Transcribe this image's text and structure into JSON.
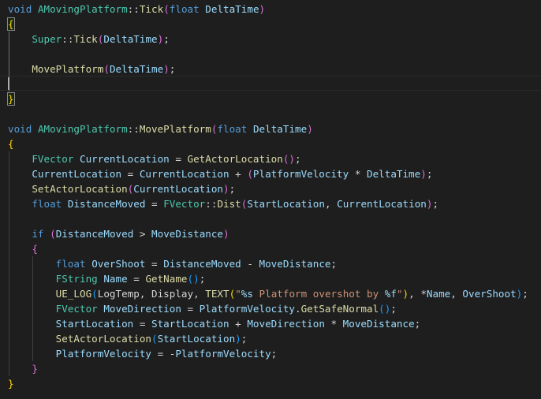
{
  "colors": {
    "background": "#1e1e1e",
    "default": "#d4d4d4",
    "keyword": "#569cd6",
    "function": "#dcdcaa",
    "type": "#4ec9b0",
    "variable": "#9cdcfe",
    "string": "#ce9178",
    "format": "#9cdcfe",
    "brace1": "#ffd700",
    "brace2": "#da70d6",
    "brace3": "#179fff"
  },
  "lines": [
    [
      [
        "void",
        "keyword"
      ],
      [
        " ",
        "default"
      ],
      [
        "AMovingPlatform",
        "type"
      ],
      [
        "::",
        "default"
      ],
      [
        "Tick",
        "function"
      ],
      [
        "(",
        "brace2"
      ],
      [
        "float",
        "keyword"
      ],
      [
        " ",
        "default"
      ],
      [
        "DeltaTime",
        "variable"
      ],
      [
        ")",
        "brace2"
      ]
    ],
    [
      [
        "{",
        "brace1"
      ]
    ],
    [
      [
        "    ",
        "default"
      ],
      [
        "Super",
        "type"
      ],
      [
        "::",
        "default"
      ],
      [
        "Tick",
        "function"
      ],
      [
        "(",
        "brace2"
      ],
      [
        "DeltaTime",
        "variable"
      ],
      [
        ")",
        "brace2"
      ],
      [
        ";",
        "default"
      ]
    ],
    [],
    [
      [
        "    ",
        "default"
      ],
      [
        "MovePlatform",
        "function"
      ],
      [
        "(",
        "brace2"
      ],
      [
        "DeltaTime",
        "variable"
      ],
      [
        ")",
        "brace2"
      ],
      [
        ";",
        "default"
      ]
    ],
    [],
    [
      [
        "}",
        "brace1"
      ]
    ],
    [],
    [
      [
        "void",
        "keyword"
      ],
      [
        " ",
        "default"
      ],
      [
        "AMovingPlatform",
        "type"
      ],
      [
        "::",
        "default"
      ],
      [
        "MovePlatform",
        "function"
      ],
      [
        "(",
        "brace2"
      ],
      [
        "float",
        "keyword"
      ],
      [
        " ",
        "default"
      ],
      [
        "DeltaTime",
        "variable"
      ],
      [
        ")",
        "brace2"
      ]
    ],
    [
      [
        "{",
        "brace1"
      ]
    ],
    [
      [
        "    ",
        "default"
      ],
      [
        "FVector",
        "type"
      ],
      [
        " ",
        "default"
      ],
      [
        "CurrentLocation",
        "variable"
      ],
      [
        " = ",
        "default"
      ],
      [
        "GetActorLocation",
        "function"
      ],
      [
        "()",
        "brace2"
      ],
      [
        ";",
        "default"
      ]
    ],
    [
      [
        "    ",
        "default"
      ],
      [
        "CurrentLocation",
        "variable"
      ],
      [
        " = ",
        "default"
      ],
      [
        "CurrentLocation",
        "variable"
      ],
      [
        " + ",
        "default"
      ],
      [
        "(",
        "brace2"
      ],
      [
        "PlatformVelocity",
        "variable"
      ],
      [
        " * ",
        "default"
      ],
      [
        "DeltaTime",
        "variable"
      ],
      [
        ")",
        "brace2"
      ],
      [
        ";",
        "default"
      ]
    ],
    [
      [
        "    ",
        "default"
      ],
      [
        "SetActorLocation",
        "function"
      ],
      [
        "(",
        "brace2"
      ],
      [
        "CurrentLocation",
        "variable"
      ],
      [
        ")",
        "brace2"
      ],
      [
        ";",
        "default"
      ]
    ],
    [
      [
        "    ",
        "default"
      ],
      [
        "float",
        "keyword"
      ],
      [
        " ",
        "default"
      ],
      [
        "DistanceMoved",
        "variable"
      ],
      [
        " = ",
        "default"
      ],
      [
        "FVector",
        "type"
      ],
      [
        "::",
        "default"
      ],
      [
        "Dist",
        "function"
      ],
      [
        "(",
        "brace2"
      ],
      [
        "StartLocation",
        "variable"
      ],
      [
        ", ",
        "default"
      ],
      [
        "CurrentLocation",
        "variable"
      ],
      [
        ")",
        "brace2"
      ],
      [
        ";",
        "default"
      ]
    ],
    [],
    [
      [
        "    ",
        "default"
      ],
      [
        "if",
        "keyword"
      ],
      [
        " ",
        "default"
      ],
      [
        "(",
        "brace2"
      ],
      [
        "DistanceMoved",
        "variable"
      ],
      [
        " > ",
        "default"
      ],
      [
        "MoveDistance",
        "variable"
      ],
      [
        ")",
        "brace2"
      ]
    ],
    [
      [
        "    ",
        "default"
      ],
      [
        "{",
        "brace2"
      ]
    ],
    [
      [
        "        ",
        "default"
      ],
      [
        "float",
        "keyword"
      ],
      [
        " ",
        "default"
      ],
      [
        "OverShoot",
        "variable"
      ],
      [
        " = ",
        "default"
      ],
      [
        "DistanceMoved",
        "variable"
      ],
      [
        " - ",
        "default"
      ],
      [
        "MoveDistance",
        "variable"
      ],
      [
        ";",
        "default"
      ]
    ],
    [
      [
        "        ",
        "default"
      ],
      [
        "FString",
        "type"
      ],
      [
        " ",
        "default"
      ],
      [
        "Name",
        "variable"
      ],
      [
        " = ",
        "default"
      ],
      [
        "GetName",
        "function"
      ],
      [
        "()",
        "brace3"
      ],
      [
        ";",
        "default"
      ]
    ],
    [
      [
        "        ",
        "default"
      ],
      [
        "UE_LOG",
        "function"
      ],
      [
        "(",
        "brace3"
      ],
      [
        "LogTemp",
        "default"
      ],
      [
        ", ",
        "default"
      ],
      [
        "Display",
        "default"
      ],
      [
        ", ",
        "default"
      ],
      [
        "TEXT",
        "function"
      ],
      [
        "(",
        "brace1"
      ],
      [
        "\"",
        "string"
      ],
      [
        "%s",
        "format"
      ],
      [
        " Platform overshot by ",
        "string"
      ],
      [
        "%f",
        "format"
      ],
      [
        "\"",
        "string"
      ],
      [
        ")",
        "brace1"
      ],
      [
        ", ",
        "default"
      ],
      [
        "*",
        "default"
      ],
      [
        "Name",
        "variable"
      ],
      [
        ", ",
        "default"
      ],
      [
        "OverShoot",
        "variable"
      ],
      [
        ")",
        "brace3"
      ],
      [
        ";",
        "default"
      ]
    ],
    [
      [
        "        ",
        "default"
      ],
      [
        "FVector",
        "type"
      ],
      [
        " ",
        "default"
      ],
      [
        "MoveDirection",
        "variable"
      ],
      [
        " = ",
        "default"
      ],
      [
        "PlatformVelocity",
        "variable"
      ],
      [
        ".",
        "default"
      ],
      [
        "GetSafeNormal",
        "function"
      ],
      [
        "()",
        "brace3"
      ],
      [
        ";",
        "default"
      ]
    ],
    [
      [
        "        ",
        "default"
      ],
      [
        "StartLocation",
        "variable"
      ],
      [
        " = ",
        "default"
      ],
      [
        "StartLocation",
        "variable"
      ],
      [
        " + ",
        "default"
      ],
      [
        "MoveDirection",
        "variable"
      ],
      [
        " * ",
        "default"
      ],
      [
        "MoveDistance",
        "variable"
      ],
      [
        ";",
        "default"
      ]
    ],
    [
      [
        "        ",
        "default"
      ],
      [
        "SetActorLocation",
        "function"
      ],
      [
        "(",
        "brace3"
      ],
      [
        "StartLocation",
        "variable"
      ],
      [
        ")",
        "brace3"
      ],
      [
        ";",
        "default"
      ]
    ],
    [
      [
        "        ",
        "default"
      ],
      [
        "PlatformVelocity",
        "variable"
      ],
      [
        " = ",
        "default"
      ],
      [
        "-",
        "default"
      ],
      [
        "PlatformVelocity",
        "variable"
      ],
      [
        ";",
        "default"
      ]
    ],
    [
      [
        "    ",
        "default"
      ],
      [
        "}",
        "brace2"
      ]
    ],
    [
      [
        "}",
        "brace1"
      ]
    ]
  ]
}
